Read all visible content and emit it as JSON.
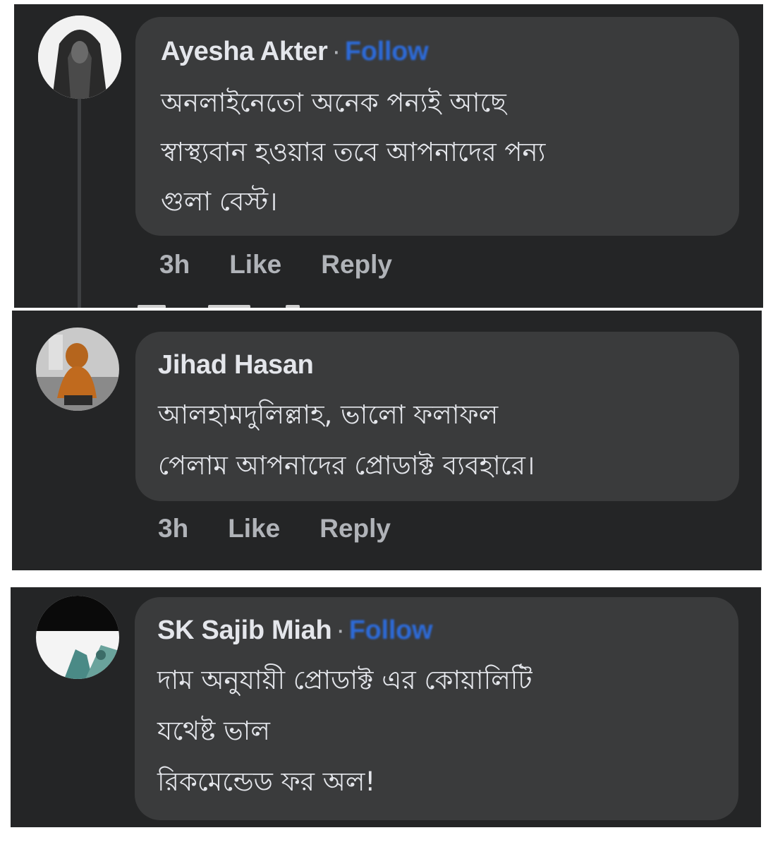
{
  "comments": [
    {
      "name": "Ayesha Akter",
      "separator": "·",
      "follow": "Follow",
      "lines": [
        "অনলাইনেতো অনেক পন্যই আছে",
        "স্বাস্থ্যবান হওয়ার তবে আপনাদের পন্য",
        "গুলা বেস্ট।"
      ],
      "time": "3h",
      "like": "Like",
      "reply": "Reply"
    },
    {
      "name": "Jihad Hasan",
      "lines": [
        "আলহামদুলিল্লাহ,  ভালো ফলাফল",
        "পেলাম আপনাদের প্রোডাক্ট ব্যবহারে।"
      ],
      "time": "3h",
      "like": "Like",
      "reply": "Reply"
    },
    {
      "name": "SK Sajib Miah",
      "separator": "·",
      "follow": "Follow",
      "lines": [
        "দাম অনুযায়ী প্রোডাক্ট এর কোয়ালিটি",
        "যথেষ্ট ভাল",
        "রিকমেন্ডেড ফর অল!"
      ]
    }
  ],
  "colors": {
    "panel_bg": "#242526",
    "bubble_bg": "#3a3b3c",
    "text_primary": "#e4e6eb",
    "text_secondary": "#b0b3b8",
    "follow_link": "#2d6bd9"
  }
}
